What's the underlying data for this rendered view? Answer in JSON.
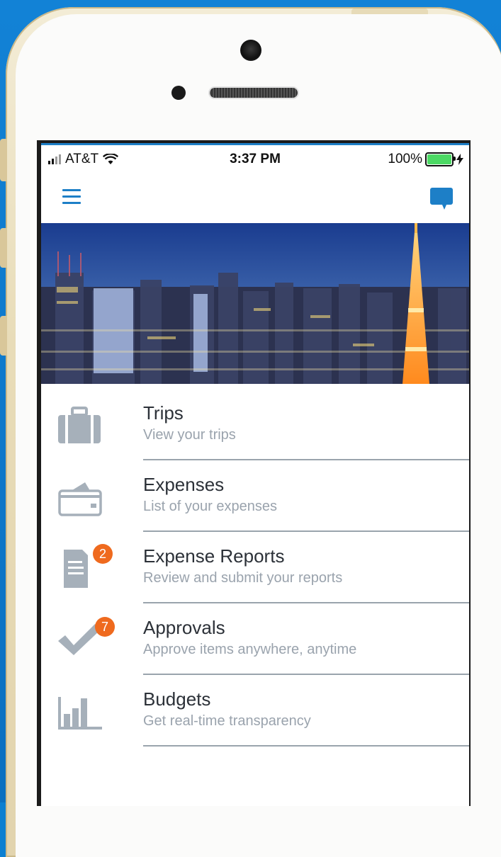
{
  "status_bar": {
    "carrier": "AT&T",
    "time": "3:37 PM",
    "battery_percent": "100%",
    "battery_level": 1.0
  },
  "app_bar": {
    "menu_icon": "hamburger-menu-icon",
    "chat_icon": "chat-bubble-icon"
  },
  "menu": {
    "items": [
      {
        "title": "Trips",
        "subtitle": "View your trips",
        "icon": "briefcase-icon",
        "badge": ""
      },
      {
        "title": "Expenses",
        "subtitle": "List of your expenses",
        "icon": "credit-card-icon",
        "badge": ""
      },
      {
        "title": "Expense Reports",
        "subtitle": "Review and submit your reports",
        "icon": "report-icon",
        "badge": "2"
      },
      {
        "title": "Approvals",
        "subtitle": "Approve items anywhere, anytime",
        "icon": "checkmark-icon",
        "badge": "7"
      },
      {
        "title": "Budgets",
        "subtitle": "Get real-time transparency",
        "icon": "bar-chart-icon",
        "badge": ""
      }
    ]
  },
  "colors": {
    "accent": "#1d7fc7",
    "badge": "#ef6a1e",
    "icon_gray": "#a6b0ba",
    "background": "#0b7fd1",
    "phone_frame": "#e8dcb8"
  }
}
